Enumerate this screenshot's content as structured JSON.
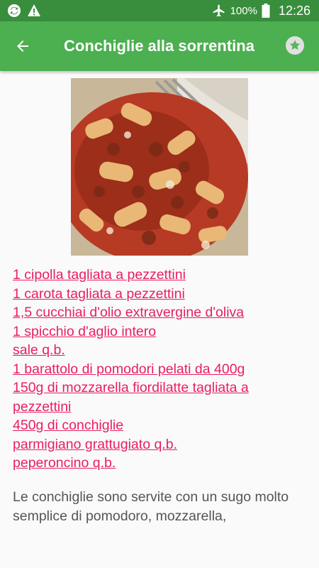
{
  "status_bar": {
    "battery": "100%",
    "time": "12:26"
  },
  "app_bar": {
    "title": "Conchiglie alla sorrentina"
  },
  "recipe": {
    "image_alt": "Conchiglie alla sorrentina",
    "ingredients": [
      "1 cipolla tagliata a pezzettini",
      "1 carota tagliata a pezzettini",
      "1,5 cucchiai d'olio extravergine d'oliva",
      "1 spicchio d'aglio intero",
      "sale q.b.",
      "1 barattolo di pomodori pelati da 400g",
      "150g di mozzarella fiordilatte tagliata a pezzettini",
      "450g di conchiglie",
      "parmigiano grattugiato q.b.",
      "peperoncino q.b."
    ],
    "description": "Le conchiglie sono servite con un sugo molto semplice di pomodoro, mozzarella,"
  },
  "colors": {
    "status_bar": "#388e3c",
    "app_bar": "#4caf50",
    "ingredient_link": "#e91e63"
  }
}
